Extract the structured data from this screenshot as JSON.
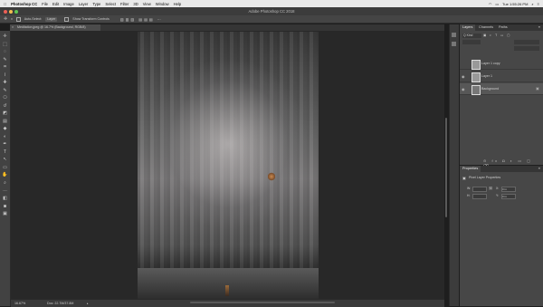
{
  "menubar": {
    "app": "Photoshop CC",
    "items": [
      "File",
      "Edit",
      "Image",
      "Layer",
      "Type",
      "Select",
      "Filter",
      "3D",
      "View",
      "Window",
      "Help"
    ],
    "clock": "Tue 1:55:26 PM"
  },
  "window_title": "Adobe Photoshop CC 2018",
  "options": {
    "auto_select": "Auto-Select:",
    "auto_select_value": "Layer",
    "show_transform": "Show Transform Controls"
  },
  "document": {
    "tab_label": "Meditation.jpeg @ 16.7% (Background, RGB/8)",
    "zoom": "16.67%",
    "doc_size": "Doc: 22.7M/37.8M"
  },
  "layers_panel": {
    "tabs": [
      "Layers",
      "Channels",
      "Paths"
    ],
    "filter_label": "Q Kind",
    "layers": [
      {
        "name": "Layer 1 copy"
      },
      {
        "name": "Layer 1"
      },
      {
        "name": "Background"
      }
    ]
  },
  "properties_panel": {
    "title": "Properties",
    "section": "Pixel Layer Properties",
    "fields": [
      {
        "label": "W:",
        "value": "",
        "label2": "X:",
        "value2": "0 in"
      },
      {
        "label": "H:",
        "value": "",
        "label2": "Y:",
        "value2": "0 in"
      }
    ]
  },
  "toolbar": {
    "icons": [
      "move-icon",
      "marquee-icon",
      "lasso-icon",
      "quick-select-icon",
      "crop-icon",
      "eyedropper-icon",
      "healing-icon",
      "brush-icon",
      "stamp-icon",
      "history-brush-icon",
      "eraser-icon",
      "gradient-icon",
      "blur-icon",
      "dodge-icon",
      "pen-icon",
      "type-icon",
      "path-select-icon",
      "shape-icon",
      "hand-icon",
      "zoom-icon",
      "more-icon",
      "colors-icon",
      "quickmask-icon",
      "screenmode-icon"
    ],
    "glyphs": [
      "✛",
      "⬚",
      "◌",
      "✎",
      "⌗",
      "⌇",
      "✚",
      "✎",
      "⎔",
      "↺",
      "◩",
      "▤",
      "◆",
      "◐",
      "✒",
      "T",
      "↖",
      "▭",
      "✋",
      "⌕",
      "…",
      "◧",
      "◙",
      "▣"
    ]
  }
}
